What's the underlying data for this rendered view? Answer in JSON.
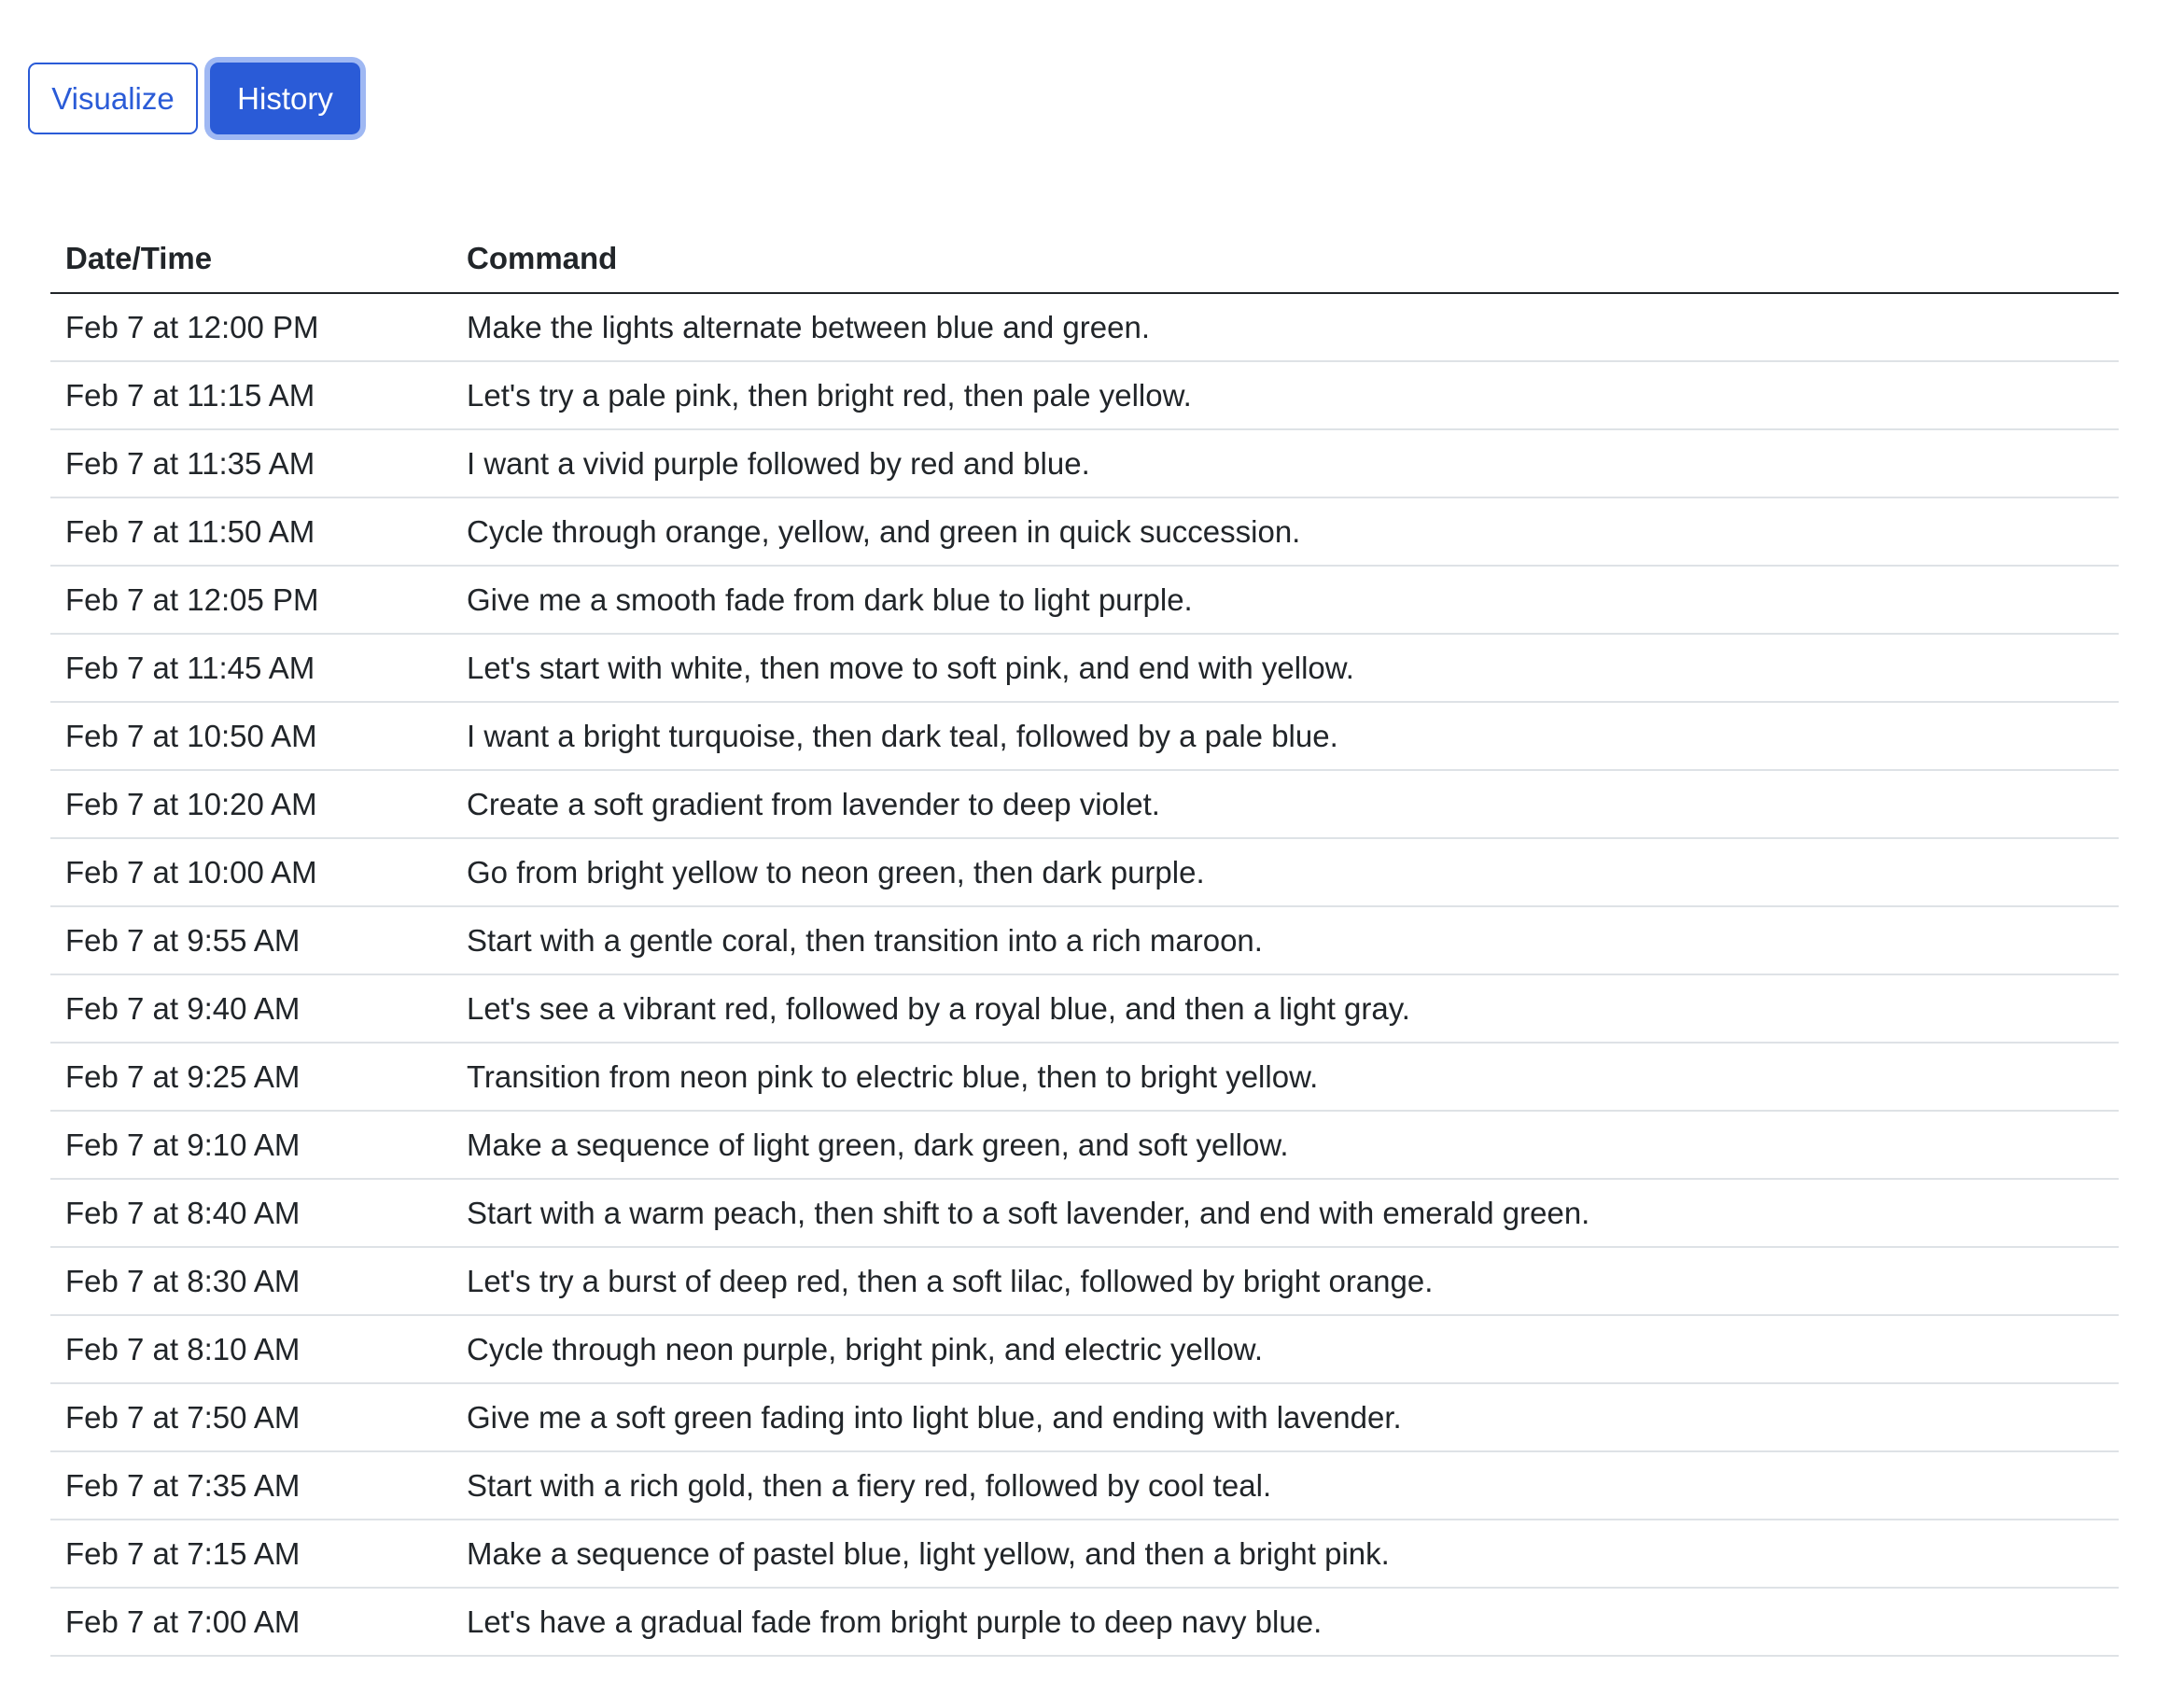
{
  "tabs": {
    "visualize_label": "Visualize",
    "history_label": "History"
  },
  "table": {
    "headers": {
      "datetime": "Date/Time",
      "command": "Command"
    },
    "rows": [
      {
        "datetime": "Feb 7 at 12:00 PM",
        "command": "Make the lights alternate between blue and green."
      },
      {
        "datetime": "Feb 7 at 11:15 AM",
        "command": "Let's try a pale pink, then bright red, then pale yellow."
      },
      {
        "datetime": "Feb 7 at 11:35 AM",
        "command": "I want a vivid purple followed by red and blue."
      },
      {
        "datetime": "Feb 7 at 11:50 AM",
        "command": "Cycle through orange, yellow, and green in quick succession."
      },
      {
        "datetime": "Feb 7 at 12:05 PM",
        "command": "Give me a smooth fade from dark blue to light purple."
      },
      {
        "datetime": "Feb 7 at 11:45 AM",
        "command": "Let's start with white, then move to soft pink, and end with yellow."
      },
      {
        "datetime": "Feb 7 at 10:50 AM",
        "command": "I want a bright turquoise, then dark teal, followed by a pale blue."
      },
      {
        "datetime": "Feb 7 at 10:20 AM",
        "command": "Create a soft gradient from lavender to deep violet."
      },
      {
        "datetime": "Feb 7 at 10:00 AM",
        "command": "Go from bright yellow to neon green, then dark purple."
      },
      {
        "datetime": "Feb 7 at 9:55 AM",
        "command": "Start with a gentle coral, then transition into a rich maroon."
      },
      {
        "datetime": "Feb 7 at 9:40 AM",
        "command": "Let's see a vibrant red, followed by a royal blue, and then a light gray."
      },
      {
        "datetime": "Feb 7 at 9:25 AM",
        "command": "Transition from neon pink to electric blue, then to bright yellow."
      },
      {
        "datetime": "Feb 7 at 9:10 AM",
        "command": "Make a sequence of light green, dark green, and soft yellow."
      },
      {
        "datetime": "Feb 7 at 8:40 AM",
        "command": "Start with a warm peach, then shift to a soft lavender, and end with emerald green."
      },
      {
        "datetime": "Feb 7 at 8:30 AM",
        "command": "Let's try a burst of deep red, then a soft lilac, followed by bright orange."
      },
      {
        "datetime": "Feb 7 at 8:10 AM",
        "command": "Cycle through neon purple, bright pink, and electric yellow."
      },
      {
        "datetime": "Feb 7 at 7:50 AM",
        "command": "Give me a soft green fading into light blue, and ending with lavender."
      },
      {
        "datetime": "Feb 7 at 7:35 AM",
        "command": "Start with a rich gold, then a fiery red, followed by cool teal."
      },
      {
        "datetime": "Feb 7 at 7:15 AM",
        "command": "Make a sequence of pastel blue, light yellow, and then a bright pink."
      },
      {
        "datetime": "Feb 7 at 7:00 AM",
        "command": "Let's have a gradual fade from bright purple to deep navy blue."
      }
    ]
  },
  "colors": {
    "accent": "#2a5bd7",
    "focus_ring": "#9fb8f3",
    "text": "#212529",
    "row_divider": "#dee2e6"
  }
}
